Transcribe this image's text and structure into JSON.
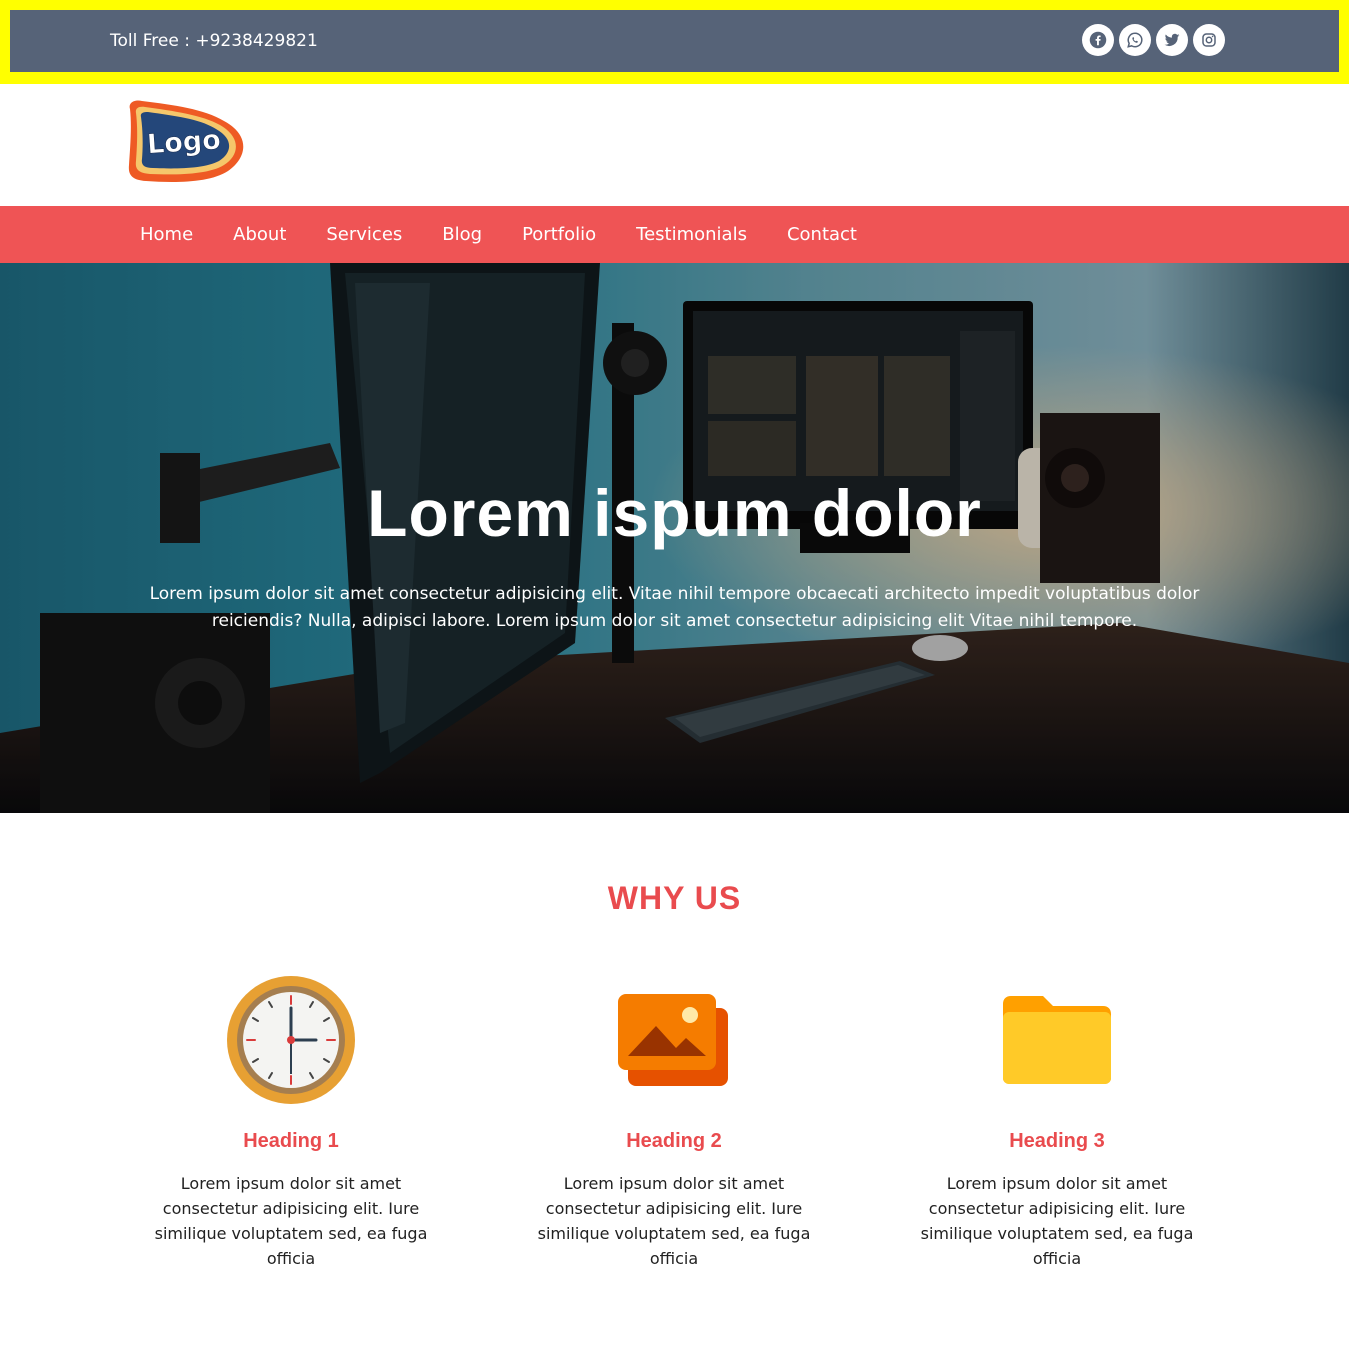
{
  "topbar": {
    "toll_free": "Toll Free : +9238429821",
    "socials": [
      {
        "icon": "facebook-icon",
        "label": "Facebook"
      },
      {
        "icon": "whatsapp-icon",
        "label": "WhatsApp"
      },
      {
        "icon": "twitter-icon",
        "label": "Twitter"
      },
      {
        "icon": "instagram-icon",
        "label": "Instagram"
      }
    ]
  },
  "logo": {
    "text": "Logo"
  },
  "nav": {
    "items": [
      "Home",
      "About",
      "Services",
      "Blog",
      "Portfolio",
      "Testimonials",
      "Contact"
    ]
  },
  "hero": {
    "title": "Lorem ispum dolor",
    "subtitle": "Lorem ipsum dolor sit amet consectetur adipisicing elit. Vitae nihil tempore obcaecati architecto impedit voluptatibus dolor reiciendis? Nulla, adipisci labore. Lorem ipsum dolor sit amet consectetur adipisicing elit Vitae nihil tempore."
  },
  "why": {
    "title": "WHY US",
    "features": [
      {
        "icon": "clock-icon",
        "heading": "Heading 1",
        "text": "Lorem ipsum dolor sit amet consectetur adipisicing elit. Iure similique voluptatem sed, ea fuga officia"
      },
      {
        "icon": "image-gallery-icon",
        "heading": "Heading 2",
        "text": "Lorem ipsum dolor sit amet consectetur adipisicing elit. Iure similique voluptatem sed, ea fuga officia"
      },
      {
        "icon": "folder-icon",
        "heading": "Heading 3",
        "text": "Lorem ipsum dolor sit amet consectetur adipisicing elit. Iure similique voluptatem sed, ea fuga officia"
      }
    ]
  },
  "colors": {
    "topbar_border": "#ffff00",
    "topbar_bg": "#566378",
    "nav_bg": "#ef5455",
    "accent": "#e94b4e"
  }
}
